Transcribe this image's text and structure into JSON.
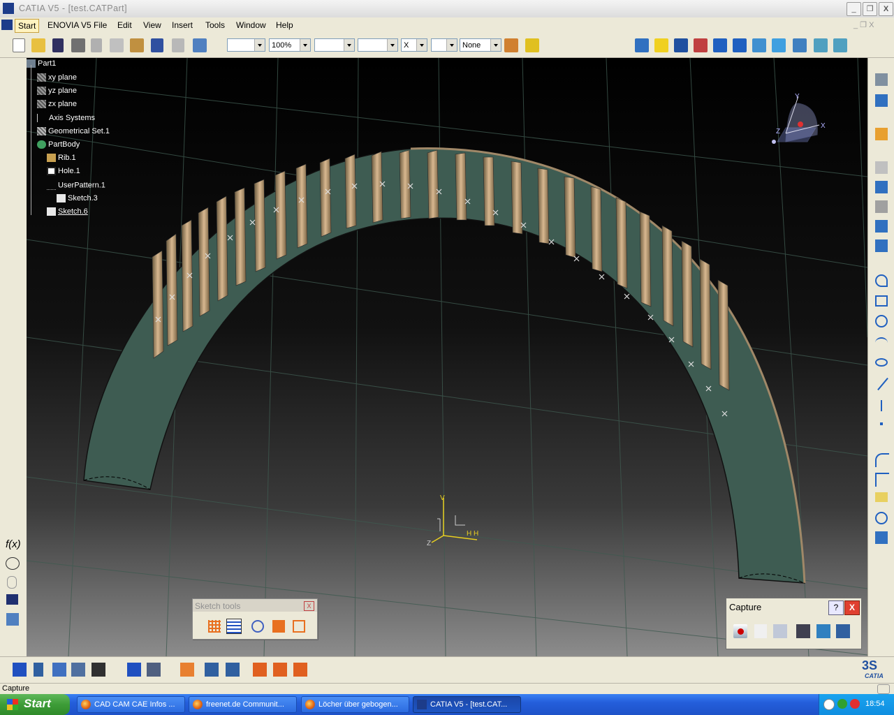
{
  "window": {
    "title": "CATIA V5 - [test.CATPart]",
    "min": "_",
    "restore": "❐",
    "close": "X"
  },
  "menu": {
    "items": [
      "Start",
      "ENOVIA V5",
      "File",
      "Edit",
      "View",
      "Insert",
      "Tools",
      "Window",
      "Help"
    ]
  },
  "toolbar": {
    "color_combo": "",
    "zoom_combo": "100%",
    "linetype_combo": "",
    "lineweight_combo": "",
    "point_combo": "X",
    "layer_combo": "None"
  },
  "tree": {
    "items": [
      "Part1",
      "xy plane",
      "yz plane",
      "zx plane",
      "Axis Systems",
      "Geometrical Set.1",
      "PartBody",
      "Rib.1",
      "Hole.1",
      "UserPattern.1",
      "Sketch.3",
      "Sketch.6"
    ]
  },
  "compass": {
    "x": "X",
    "y": "Y",
    "z": "Z"
  },
  "axis_origin": {
    "v": "V",
    "h": "H H",
    "z": "Z"
  },
  "sketch_tools": {
    "title": "Sketch tools",
    "close": "X"
  },
  "capture_panel": {
    "title": "Capture",
    "help": "?",
    "close": "X"
  },
  "status": {
    "text": "Capture"
  },
  "taskbar": {
    "start": "Start",
    "tasks": [
      "CAD CAM CAE Infos ...",
      "freenet.de Communit...",
      "Löcher über gebogen...",
      "CATIA V5 - [test.CAT..."
    ],
    "clock": "18:54"
  },
  "brand": {
    "logo_text": "CATIA"
  }
}
